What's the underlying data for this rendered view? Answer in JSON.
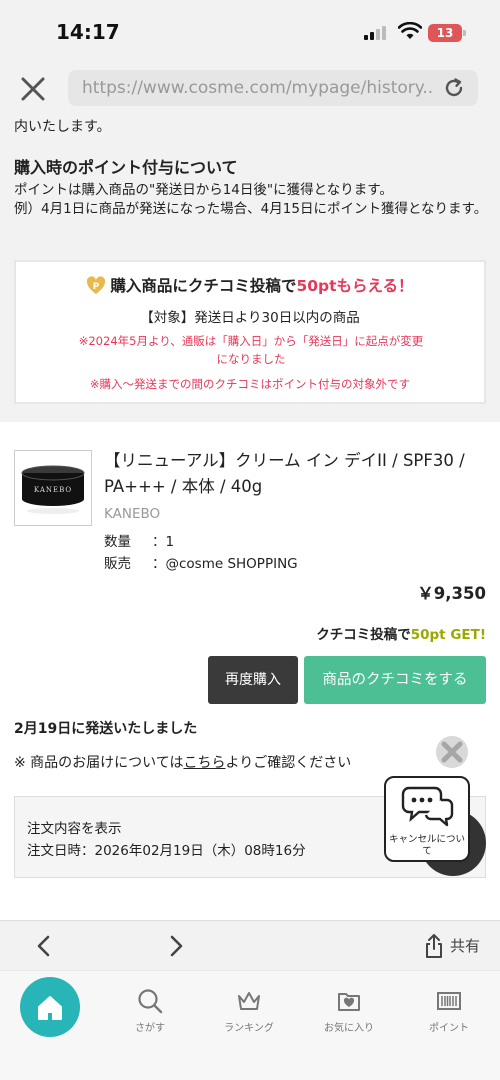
{
  "status_bar": {
    "time": "14:17",
    "battery": "13"
  },
  "browser": {
    "url": "https://www.cosme.com/mypage/history...."
  },
  "info": {
    "cut_text": "内いたします。",
    "point_heading": "購入時のポイント付与について",
    "point_desc_1": "ポイントは購入商品の\"発送日から14日後\"に獲得となります。",
    "point_desc_2": "例）4月1日に商品が発送になった場合、4月15日にポイント獲得となります。"
  },
  "review_campaign": {
    "title_prefix": "購入商品にクチコミ投稿で",
    "title_points": "50ptもらえる！",
    "target": "【対象】発送日より30日以内の商品",
    "note1": "※2024年5月より、通販は「購入日」から「発送日」に起点が変更になりました",
    "note2": "※購入～発送までの間のクチコミはポイント付与の対象外です"
  },
  "order": {
    "product_name": "【リニューアル】クリーム イン デイII / SPF30 / PA+++ / 本体 / 40g",
    "brand": "KANEBO",
    "qty_label": "数量",
    "qty_value": "：1",
    "seller_label": "販売",
    "seller_value": "：@cosme SHOPPING",
    "price": "￥9,350",
    "review_promo_prefix": "クチコミ投稿で",
    "review_promo_points": "50pt GET!",
    "rebuy_label": "再度購入",
    "review_button_label": "商品のクチコミをする",
    "ship_status": "2月19日に発送いたしました",
    "delivery_prefix": "※ 商品のお届けについては",
    "delivery_link": "こちら",
    "delivery_suffix": "よりご確認ください",
    "show_order_label": "注文内容を表示",
    "order_date": "注文日時：2026年02月19日（木）08時16分",
    "thumb_brand": "KANEBO"
  },
  "cancel_widget": {
    "label": "キャンセルについて"
  },
  "nav_toolbar": {
    "share_label": "共有"
  },
  "app_nav": {
    "items": [
      {
        "label": "さがす",
        "icon": "search-icon"
      },
      {
        "label": "ランキング",
        "icon": "crown-icon"
      },
      {
        "label": "お気に入り",
        "icon": "favorite-icon"
      },
      {
        "label": "ポイント",
        "icon": "barcode-icon"
      }
    ]
  },
  "colors": {
    "accent_pink": "#e8385a",
    "review_green": "#4cbf95",
    "home_teal": "#27b5b8",
    "points_olive": "#9aa800"
  }
}
